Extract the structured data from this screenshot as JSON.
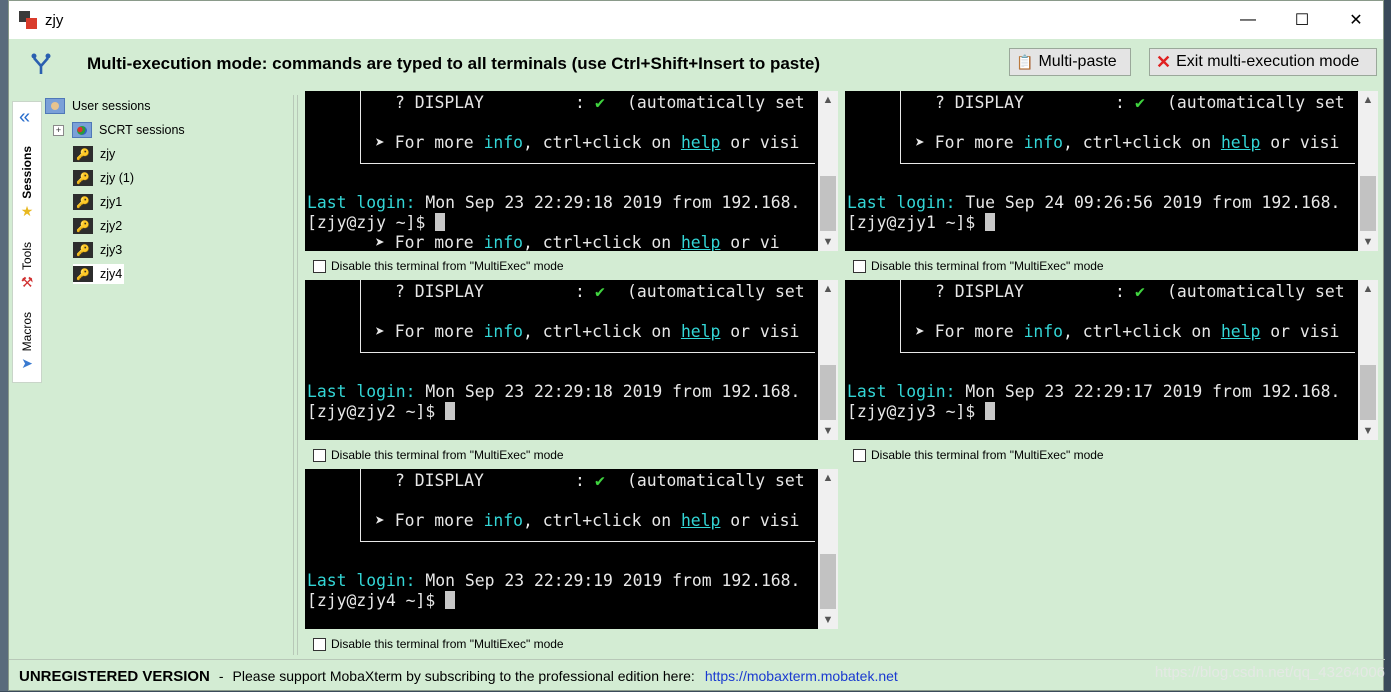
{
  "window": {
    "title": "zjy"
  },
  "window_controls": {
    "minimize": "—",
    "maximize": "☐",
    "close": "✕"
  },
  "multiexec": {
    "message": "Multi-execution mode: commands are typed to all terminals (use Ctrl+Shift+Insert to paste)",
    "multipaste_label": "Multi-paste",
    "exit_label": "Exit multi-execution mode"
  },
  "sidebar": {
    "tabs": [
      {
        "label": "Sessions"
      },
      {
        "label": "Tools"
      },
      {
        "label": "Macros"
      }
    ]
  },
  "session_tree": {
    "root": "User sessions",
    "folder": "SCRT sessions",
    "sessions": [
      "zjy",
      "zjy (1)",
      "zjy1",
      "zjy2",
      "zjy3",
      "zjy4"
    ],
    "selected": "zjy4"
  },
  "terminals": [
    {
      "display_line": "? DISPLAY",
      "display_colon": ":",
      "display_check": "✔",
      "display_rest": "(automatically set",
      "info_pre": "➤ For more ",
      "info_word": "info",
      "info_mid": ", ctrl+click on ",
      "help_word": "help",
      "info_post": " or visi",
      "last_login_label": "Last login:",
      "last_login_value": " Mon Sep 23 22:29:18 2019 from 192.168.",
      "prompt": "[zjy@zjy ~]$ ",
      "extra_pre": "➤ For more ",
      "extra_info": "info",
      "extra_mid": ", ctrl+click on ",
      "extra_help": "help",
      "extra_post": " or vi",
      "disable_label": "Disable this terminal from \"MultiExec\" mode"
    },
    {
      "display_line": "? DISPLAY",
      "display_colon": ":",
      "display_check": "✔",
      "display_rest": "(automatically set",
      "info_pre": "➤ For more ",
      "info_word": "info",
      "info_mid": ", ctrl+click on ",
      "help_word": "help",
      "info_post": " or visi",
      "last_login_label": "Last login:",
      "last_login_value": " Tue Sep 24 09:26:56 2019 from 192.168.",
      "prompt": "[zjy@zjy1 ~]$ ",
      "disable_label": "Disable this terminal from \"MultiExec\" mode"
    },
    {
      "display_line": "? DISPLAY",
      "display_colon": ":",
      "display_check": "✔",
      "display_rest": "(automatically set",
      "info_pre": "➤ For more ",
      "info_word": "info",
      "info_mid": ", ctrl+click on ",
      "help_word": "help",
      "info_post": " or visi",
      "last_login_label": "Last login:",
      "last_login_value": " Mon Sep 23 22:29:18 2019 from 192.168.",
      "prompt": "[zjy@zjy2 ~]$ ",
      "disable_label": "Disable this terminal from \"MultiExec\" mode"
    },
    {
      "display_line": "? DISPLAY",
      "display_colon": ":",
      "display_check": "✔",
      "display_rest": "(automatically set",
      "info_pre": "➤ For more ",
      "info_word": "info",
      "info_mid": ", ctrl+click on ",
      "help_word": "help",
      "info_post": " or visi",
      "last_login_label": "Last login:",
      "last_login_value": " Mon Sep 23 22:29:17 2019 from 192.168.",
      "prompt": "[zjy@zjy3 ~]$ ",
      "disable_label": "Disable this terminal from \"MultiExec\" mode"
    },
    {
      "display_line": "? DISPLAY",
      "display_colon": ":",
      "display_check": "✔",
      "display_rest": "(automatically set",
      "info_pre": "➤ For more ",
      "info_word": "info",
      "info_mid": ", ctrl+click on ",
      "help_word": "help",
      "info_post": " or visi",
      "last_login_label": "Last login:",
      "last_login_value": " Mon Sep 23 22:29:19 2019 from 192.168.",
      "prompt": "[zjy@zjy4 ~]$ ",
      "disable_label": "Disable this terminal from \"MultiExec\" mode"
    }
  ],
  "statusbar": {
    "unregistered": "UNREGISTERED VERSION",
    "dash": "-",
    "message": "Please support MobaXterm by subscribing to the professional edition here:",
    "link": "https://mobaxterm.mobatek.net",
    "watermark": "https://blog.csdn.net/qq_43264006"
  },
  "colors": {
    "window_bg": "#d3ecd3",
    "terminal_bg": "#000000",
    "terminal_cyan": "#33d6d6",
    "terminal_green": "#3fd33f",
    "link": "#1a3ad0",
    "exit_icon": "#e02020"
  }
}
